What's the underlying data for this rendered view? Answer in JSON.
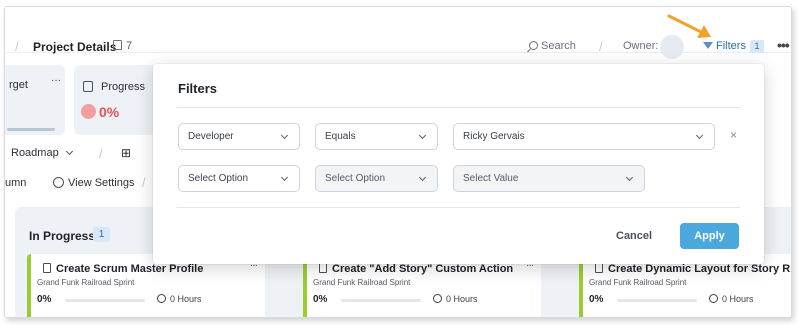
{
  "header": {
    "project_title": "Project Details",
    "item_count": "7",
    "search_label": "Search",
    "owner_label": "Owner:",
    "filters_label": "Filters",
    "filters_count": "1",
    "more": "•••"
  },
  "summary": {
    "target_label": "rget",
    "target_more": "···",
    "progress_label": "Progress",
    "progress_value": "0%"
  },
  "toolbar": {
    "roadmap_label": "Roadmap",
    "column_label": "umn",
    "view_settings_label": "View Settings"
  },
  "board": {
    "column_title": "In Progress",
    "column_count": "1",
    "cards": [
      {
        "title": "Create Scrum Master Profile",
        "sprint": "Grand Funk Railroad Sprint",
        "percent": "0%",
        "hours": "0 Hours",
        "more": "···"
      },
      {
        "title": "Create \"Add Story\" Custom Action",
        "sprint": "Grand Funk Railroad Sprint",
        "percent": "0%",
        "hours": "0 Hours",
        "more": "···"
      },
      {
        "title": "Create Dynamic Layout for Story R...",
        "sprint": "Grand Funk Railroad Sprint",
        "percent": "0%",
        "hours": "0 Hours",
        "more": "···"
      }
    ]
  },
  "filters_modal": {
    "title": "Filters",
    "rows": [
      {
        "field": "Developer",
        "operator": "Equals",
        "value": "Ricky Gervais",
        "remove": "×"
      },
      {
        "field": "Select Option",
        "operator": "Select Option",
        "value": "Select Value"
      }
    ],
    "cancel_label": "Cancel",
    "apply_label": "Apply"
  },
  "colors": {
    "accent": "#4aa8dc",
    "progress_red": "#e05353",
    "card_border": "#9acd32",
    "arrow": "#f0a22a"
  }
}
